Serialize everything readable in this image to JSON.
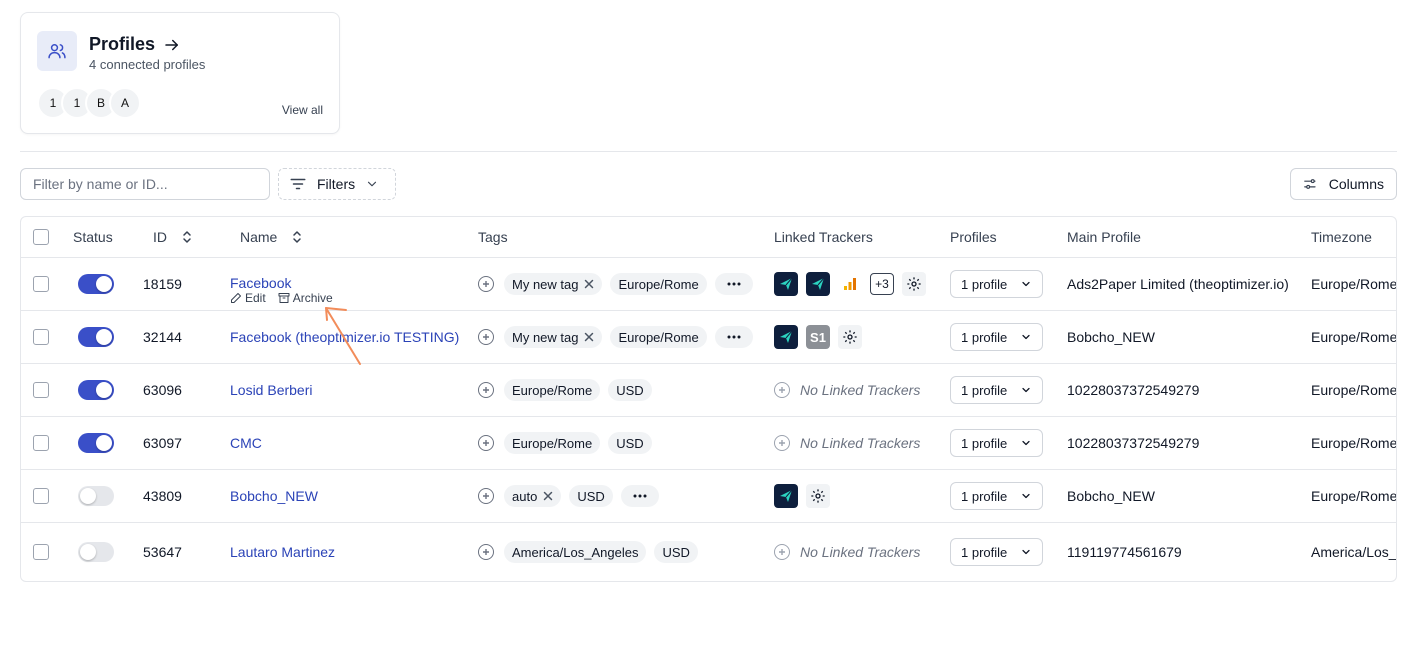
{
  "profiles_card": {
    "title": "Profiles",
    "subtitle": "4 connected profiles",
    "avatars": [
      "1",
      "1",
      "B",
      "A"
    ],
    "view_all": "View all"
  },
  "toolbar": {
    "filter_placeholder": "Filter by name or ID...",
    "filters_label": "Filters",
    "columns_label": "Columns"
  },
  "table": {
    "headers": {
      "status": "Status",
      "id": "ID",
      "name": "Name",
      "tags": "Tags",
      "linked_trackers": "Linked Trackers",
      "profiles": "Profiles",
      "main_profile": "Main Profile",
      "timezone": "Timezone"
    },
    "row_actions": {
      "edit": "Edit",
      "archive": "Archive"
    },
    "no_trackers_label": "No Linked Trackers",
    "rows": [
      {
        "status": true,
        "id": "18159",
        "name": "Facebook",
        "tags": [
          "My new tag",
          "Europe/Rome"
        ],
        "tags_removable": [
          true,
          false
        ],
        "has_more": true,
        "trackers": [
          "dark",
          "dark",
          "analytics"
        ],
        "tracker_extra": "+3",
        "profiles": "1 profile",
        "main_profile": "Ads2Paper Limited (theoptimizer.io)",
        "timezone": "Europe/Rome"
      },
      {
        "status": true,
        "id": "32144",
        "name": "Facebook (theoptimizer.io TESTING)",
        "tags": [
          "My new tag",
          "Europe/Rome"
        ],
        "tags_removable": [
          true,
          false
        ],
        "has_more": true,
        "trackers": [
          "dark",
          "s1"
        ],
        "tracker_s1_text": "S1",
        "profiles": "1 profile",
        "main_profile": "Bobcho_NEW",
        "timezone": "Europe/Rome"
      },
      {
        "status": true,
        "id": "63096",
        "name": "Losid Berberi",
        "tags": [
          "Europe/Rome",
          "USD"
        ],
        "tags_removable": [
          false,
          false
        ],
        "has_more": false,
        "trackers": [],
        "profiles": "1 profile",
        "main_profile": "10228037372549279",
        "timezone": "Europe/Rome"
      },
      {
        "status": true,
        "id": "63097",
        "name": "CMC",
        "tags": [
          "Europe/Rome",
          "USD"
        ],
        "tags_removable": [
          false,
          false
        ],
        "has_more": false,
        "trackers": [],
        "profiles": "1 profile",
        "main_profile": "10228037372549279",
        "timezone": "Europe/Rome"
      },
      {
        "status": false,
        "id": "43809",
        "name": "Bobcho_NEW",
        "tags": [
          "auto",
          "USD"
        ],
        "tags_removable": [
          true,
          false
        ],
        "has_more": true,
        "trackers": [
          "dark"
        ],
        "profiles": "1 profile",
        "main_profile": "Bobcho_NEW",
        "timezone": "Europe/Rome"
      },
      {
        "status": false,
        "id": "53647",
        "name": "Lautaro Martinez",
        "tags": [
          "America/Los_Angeles",
          "USD"
        ],
        "tags_removable": [
          false,
          false
        ],
        "has_more": false,
        "trackers": [],
        "profiles": "1 profile",
        "main_profile": "119119774561679",
        "timezone": "America/Los_Angeles"
      }
    ]
  },
  "colors": {
    "accent": "#3a4fc8",
    "link": "#2b43b7",
    "annotation_arrow": "#f28c5a",
    "tracker_dark": "#0e1f3d",
    "tracker_teal": "#2bd4c0"
  }
}
